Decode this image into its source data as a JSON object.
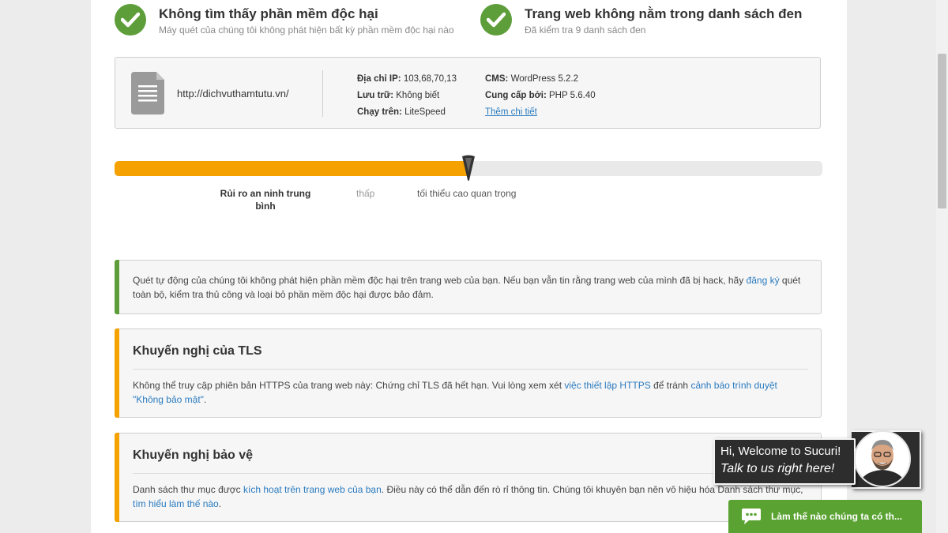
{
  "status": {
    "malware": {
      "title": "Không tìm thấy phần mềm độc hại",
      "subtitle": "Máy quét của chúng tôi không phát hiện bất kỳ phần mềm độc hại nào"
    },
    "blacklist": {
      "title": "Trang web không nằm trong danh sách đen",
      "subtitle": "Đã kiểm tra 9 danh sách đen"
    }
  },
  "site_info": {
    "url": "http://dichvuthamtutu.vn/",
    "ip_label": "Địa chỉ IP:",
    "ip_value": "103,68,70,13",
    "hosting_label": "Lưu trữ:",
    "hosting_value": "Không biết",
    "running_label": "Chạy trên:",
    "running_value": "LiteSpeed",
    "cms_label": "CMS:",
    "cms_value": "WordPress 5.2.2",
    "powered_label": "Cung cấp bởi:",
    "powered_value": "PHP 5.6.40",
    "more_details": "Thêm chi tiết"
  },
  "risk": {
    "level_fraction": 0.5,
    "current_label": "Rủi ro an ninh trung bình",
    "low_label": "thấp",
    "scale_label": "tối thiểu cao quan trọng"
  },
  "notices": {
    "scan": {
      "text_before": "Quét tự động của chúng tôi không phát hiện phần mềm độc hại trên trang web của bạn. Nếu bạn vẫn tin rằng trang web của mình đã bị hack, hãy ",
      "link": "đăng ký",
      "text_after": " quét toàn bộ, kiểm tra thủ công và loại bỏ phần mềm độc hại được bảo đảm."
    },
    "tls": {
      "title": "Khuyến nghị của TLS",
      "text_1": "Không thể truy cập phiên bản HTTPS của trang web này: Chứng chỉ TLS đã hết hạn. Vui lòng xem xét ",
      "link_1": "việc thiết lập HTTPS",
      "text_2": " để tránh ",
      "link_2": "cảnh báo trình duyệt \"Không bảo mật\"",
      "text_3": "."
    },
    "protection": {
      "title": "Khuyến nghị bảo vệ",
      "text_1": "Danh sách thư mục được ",
      "link_1": "kích hoạt trên trang web của bạn",
      "text_2": ". Điều này có thể dẫn đến rò rỉ thông tin. Chúng tôi khuyên bạn nên vô hiệu hóa Danh sách thư mục, ",
      "link_2": "tìm hiểu làm thế nào",
      "text_3": "."
    }
  },
  "chat": {
    "greeting": "Hi, Welcome to Sucuri!",
    "invite": "Talk to us right here!",
    "button_label": "Làm thế nào chúng ta có th..."
  },
  "colors": {
    "green": "#5e9e3a",
    "orange": "#f5a100",
    "link": "#2b7bbf",
    "chat_green": "#5aa332"
  },
  "icons": [
    "check-icon",
    "document-icon",
    "risk-needle-icon",
    "chat-icon"
  ]
}
